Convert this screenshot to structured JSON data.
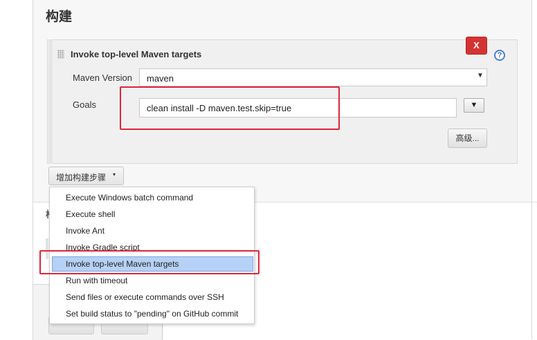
{
  "section": {
    "title": "构建"
  },
  "build_step": {
    "title": "Invoke top-level Maven targets",
    "delete_label": "X",
    "help_label": "?",
    "maven_version": {
      "label": "Maven Version",
      "value": "maven"
    },
    "goals": {
      "label": "Goals",
      "value": "clean install -D maven.test.skip=true"
    },
    "expand_label": "▼",
    "advanced_label": "高级..."
  },
  "add_step_button": {
    "label": "增加构建步骤",
    "caret": "▾"
  },
  "dropdown_menu": {
    "items": [
      "Execute Windows batch command",
      "Execute shell",
      "Invoke Ant",
      "Invoke Gradle script",
      "Invoke top-level Maven targets",
      "Run with timeout",
      "Send files or execute commands over SSH",
      "Set build status to \"pending\" on GitHub commit"
    ],
    "selected": "Invoke top-level Maven targets"
  },
  "hidden_section_fragment": "构",
  "colors": {
    "highlight_border": "#e0243a",
    "delete_button": "#d43333",
    "menu_selection": "#b5d1f5",
    "help_icon": "#4a7fd0"
  }
}
